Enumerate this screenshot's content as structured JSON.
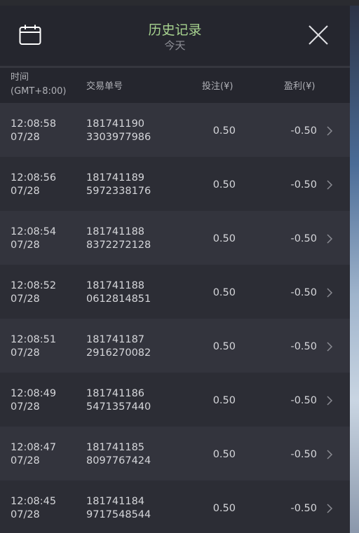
{
  "header": {
    "title": "历史记录",
    "subtitle": "今天",
    "calendar_icon": "calendar-icon",
    "close_icon": "close-icon"
  },
  "columns": {
    "time_line1": "时间",
    "time_line2": "(GMT+8:00)",
    "order": "交易单号",
    "bet": "投注(¥)",
    "profit": "盈利(¥)"
  },
  "colors": {
    "title": "#a7d38f",
    "panel_bg": "#25262e",
    "row_odd": "#33343d",
    "row_even": "#2c2d35",
    "text": "#d5d6da"
  },
  "rows": [
    {
      "time": "12:08:58",
      "date": "07/28",
      "order_1": "181741190",
      "order_2": "3303977986",
      "bet": "0.50",
      "profit": "-0.50"
    },
    {
      "time": "12:08:56",
      "date": "07/28",
      "order_1": "181741189",
      "order_2": "5972338176",
      "bet": "0.50",
      "profit": "-0.50"
    },
    {
      "time": "12:08:54",
      "date": "07/28",
      "order_1": "181741188",
      "order_2": "8372272128",
      "bet": "0.50",
      "profit": "-0.50"
    },
    {
      "time": "12:08:52",
      "date": "07/28",
      "order_1": "181741188",
      "order_2": "0612814851",
      "bet": "0.50",
      "profit": "-0.50"
    },
    {
      "time": "12:08:51",
      "date": "07/28",
      "order_1": "181741187",
      "order_2": "2916270082",
      "bet": "0.50",
      "profit": "-0.50"
    },
    {
      "time": "12:08:49",
      "date": "07/28",
      "order_1": "181741186",
      "order_2": "5471357440",
      "bet": "0.50",
      "profit": "-0.50"
    },
    {
      "time": "12:08:47",
      "date": "07/28",
      "order_1": "181741185",
      "order_2": "8097767424",
      "bet": "0.50",
      "profit": "-0.50"
    },
    {
      "time": "12:08:45",
      "date": "07/28",
      "order_1": "181741184",
      "order_2": "9717548544",
      "bet": "0.50",
      "profit": "-0.50"
    }
  ]
}
